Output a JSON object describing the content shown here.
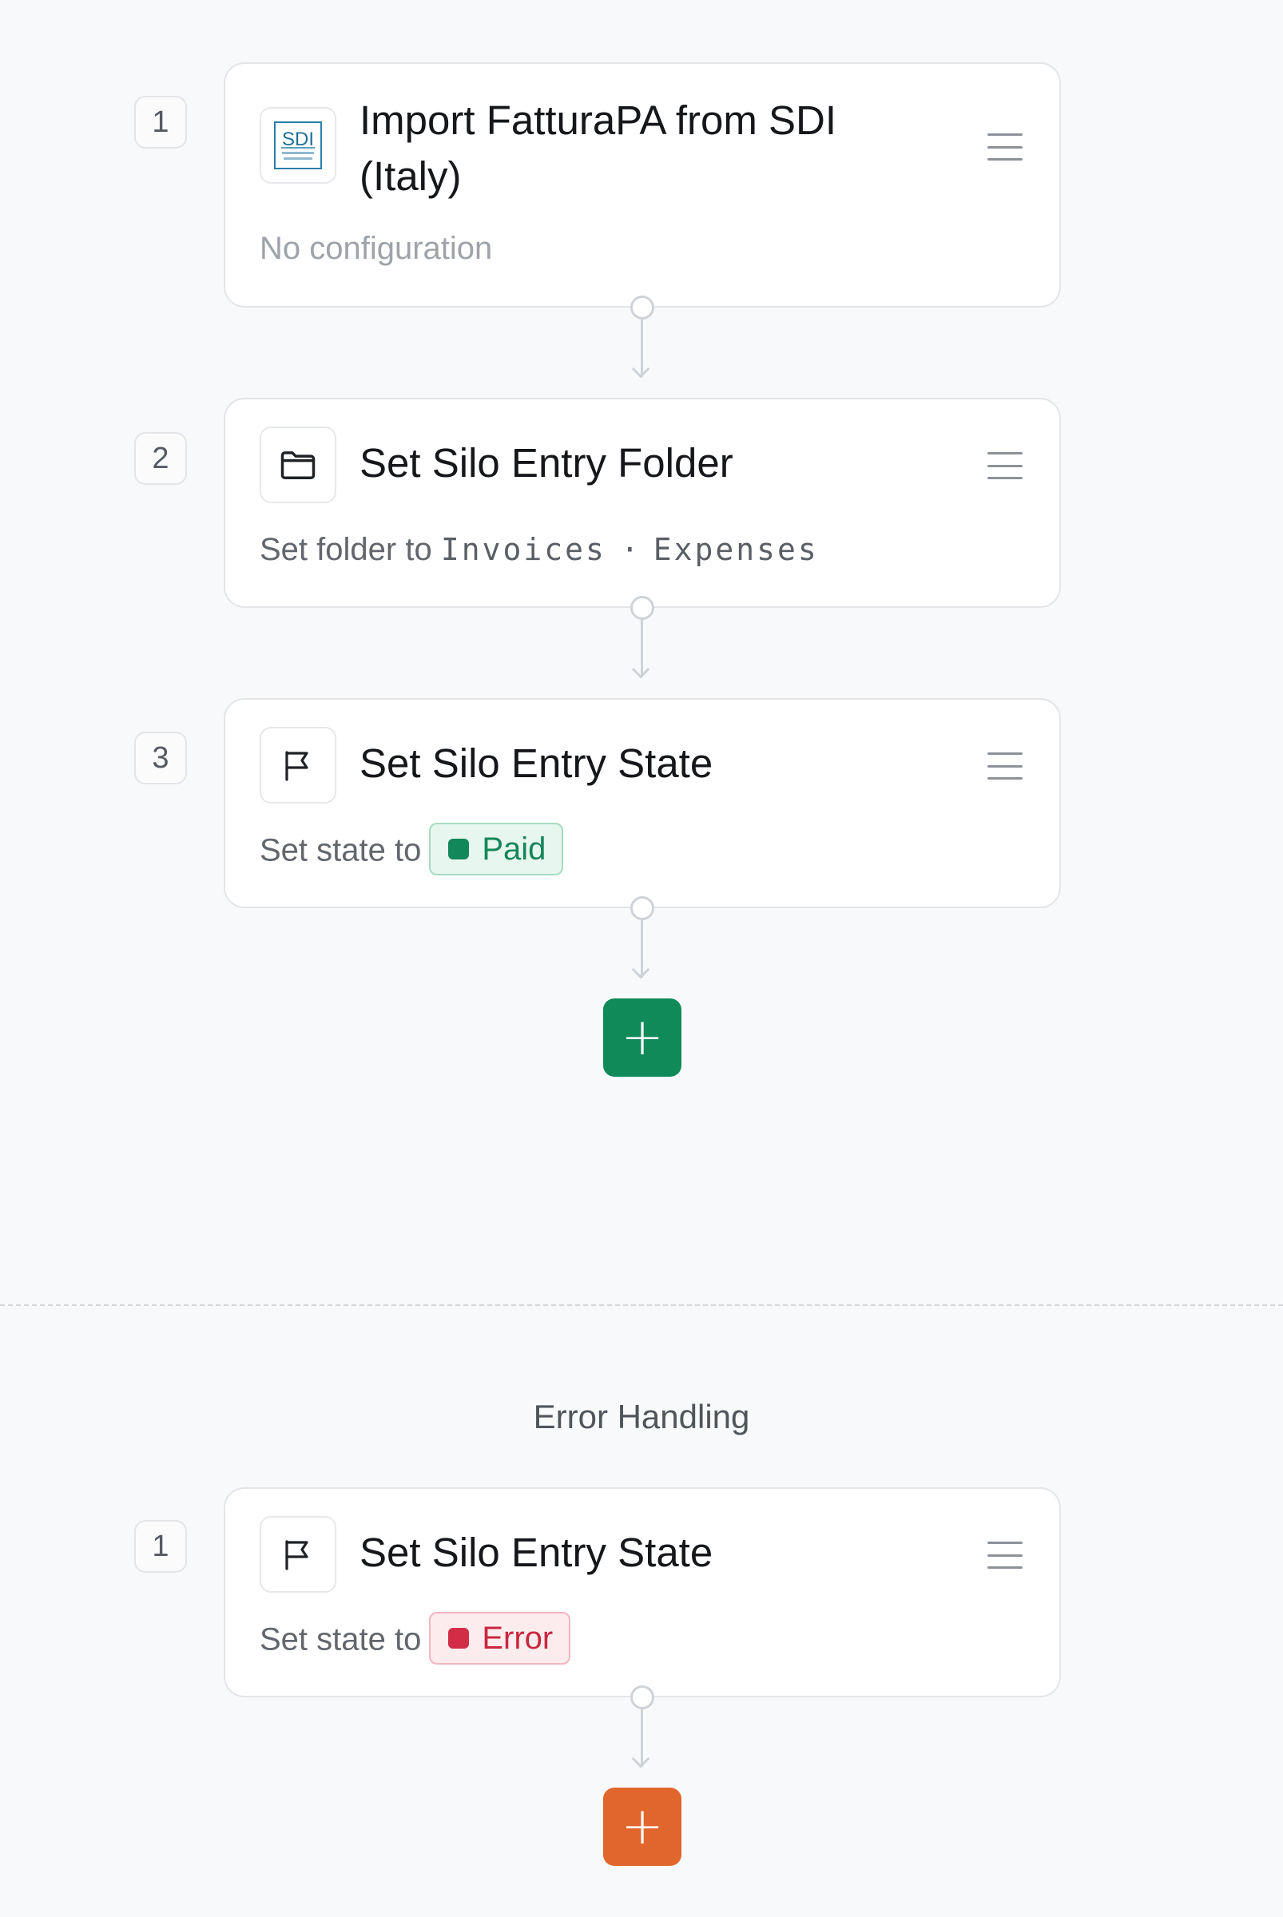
{
  "main_flow": {
    "steps": [
      {
        "number": "1",
        "title_line1": "Import FatturaPA from SDI",
        "title_line2": "(Italy)",
        "icon": "sdi-logo-icon",
        "icon_text": "SDI",
        "description": "No configuration"
      },
      {
        "number": "2",
        "title": "Set Silo Entry Folder",
        "icon": "folder-icon",
        "description_prefix": "Set folder to",
        "folder_path": [
          "Invoices",
          "Expenses"
        ],
        "path_separator": "·"
      },
      {
        "number": "3",
        "title": "Set Silo Entry State",
        "icon": "flag-icon",
        "description_prefix": "Set state to",
        "state": {
          "label": "Paid",
          "color": "#12875a"
        }
      }
    ],
    "add_button": {
      "label": "+",
      "color": "#0f8a58"
    }
  },
  "error_handling": {
    "section_title": "Error Handling",
    "steps": [
      {
        "number": "1",
        "title": "Set Silo Entry State",
        "icon": "flag-icon",
        "description_prefix": "Set state to",
        "state": {
          "label": "Error",
          "color": "#d22d46"
        }
      }
    ],
    "add_button": {
      "label": "+",
      "color": "#e0662b"
    }
  }
}
